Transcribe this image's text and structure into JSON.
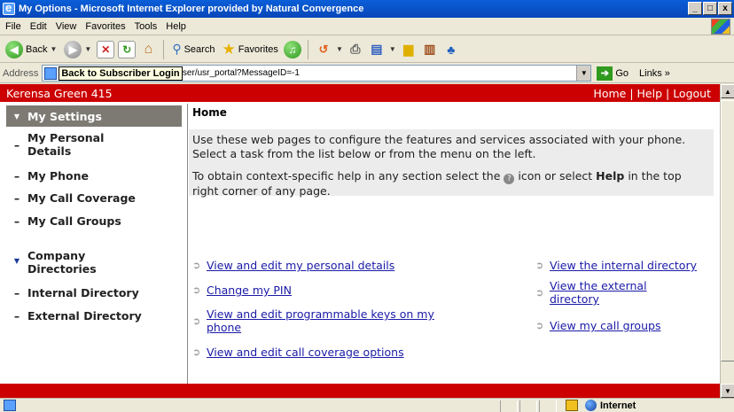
{
  "window": {
    "title": "My Options - Microsoft Internet Explorer provided by Natural Convergence",
    "buttons": [
      "_",
      "□",
      "x"
    ]
  },
  "menubar": [
    "File",
    "Edit",
    "View",
    "Favorites",
    "Tools",
    "Help"
  ],
  "toolbar": {
    "back": "Back",
    "search": "Search",
    "favorites": "Favorites"
  },
  "addressbar": {
    "label": "Address",
    "tooltip": "Back to Subscriber Login",
    "url_visible": "user/usr_portal?MessageID=-1",
    "go": "Go",
    "links": "Links »"
  },
  "page": {
    "user": "Kerensa Green 415",
    "toplinks": [
      "Home",
      "Help",
      "Logout"
    ],
    "title": "Home",
    "intro1": "Use these web pages to configure the features and services associated with your phone. Select a task from the list below or from the menu on the left.",
    "intro2_a": "To obtain context-specific help in any section select the",
    "intro2_b": "icon or select",
    "intro2_help": "Help",
    "intro2_c": "in the top right corner of any page.",
    "links_left": [
      "View and edit my personal details",
      "Change my PIN",
      "View and edit programmable keys on my phone",
      "View and edit call coverage options"
    ],
    "links_right": [
      "View the internal directory",
      "View the external directory",
      "View my call groups"
    ]
  },
  "sidebar": {
    "selected": "My Settings",
    "items": [
      {
        "label": "My Personal Details",
        "bullet": "–"
      },
      {
        "label": "My Phone",
        "bullet": "–"
      },
      {
        "label": "My Call Coverage",
        "bullet": "–"
      },
      {
        "label": "My Call Groups",
        "bullet": "–"
      },
      {
        "label": "Company Directories",
        "bullet": "▼"
      },
      {
        "label": "Internal Directory",
        "bullet": "–"
      },
      {
        "label": "External Directory",
        "bullet": "–"
      }
    ]
  },
  "statusbar": {
    "zone": "Internet"
  }
}
